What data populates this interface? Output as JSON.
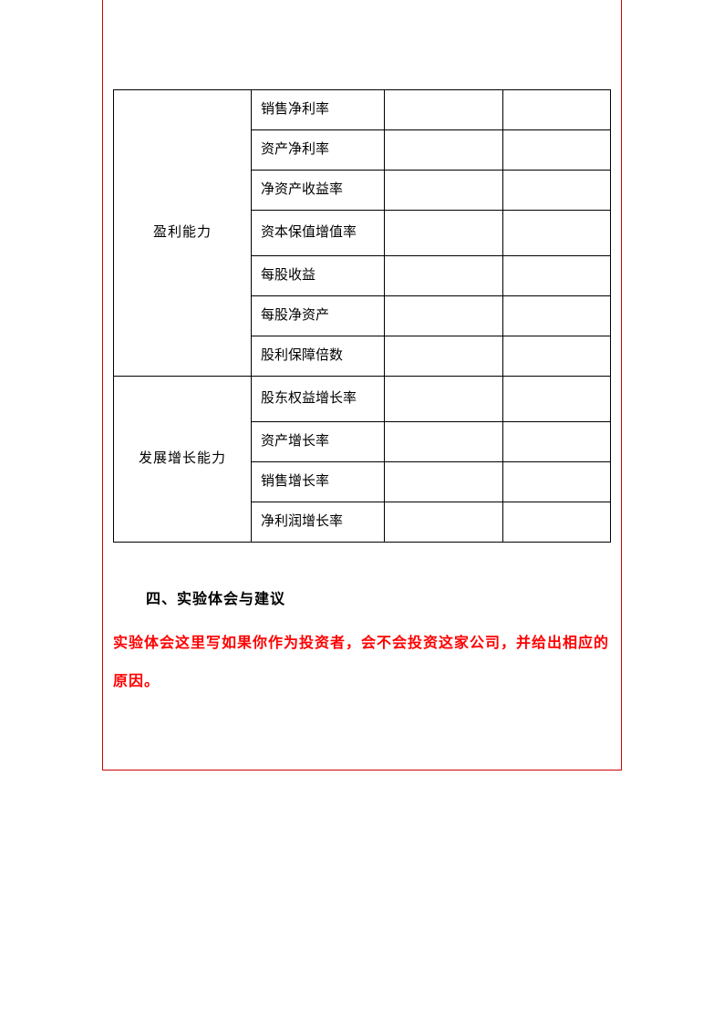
{
  "table": {
    "categories": [
      {
        "label": "盈利能力",
        "metrics": [
          "销售净利率",
          "资产净利率",
          "净资产收益率",
          "资本保值增值率",
          "每股收益",
          "每股净资产",
          "股利保障倍数"
        ]
      },
      {
        "label": "发展增长能力",
        "metrics": [
          "股东权益增长率",
          "资产增长率",
          "销售增长率",
          "净利润增长率"
        ]
      }
    ]
  },
  "section": {
    "title": "四、实验体会与建议",
    "body": "实验体会这里写如果你作为投资者，会不会投资这家公司，并给出相应的原因。"
  }
}
